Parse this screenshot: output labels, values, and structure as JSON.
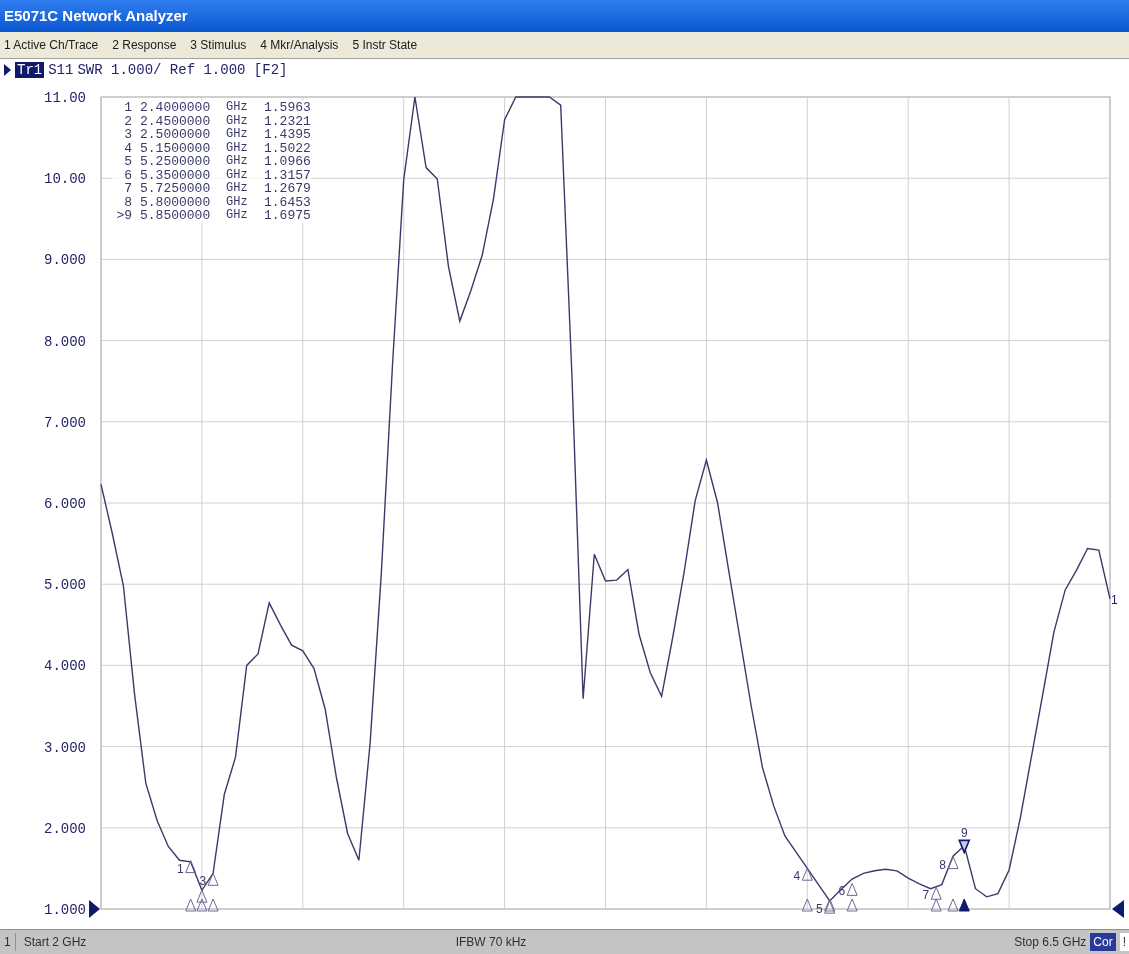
{
  "window": {
    "title": "E5071C Network Analyzer"
  },
  "menu": [
    "1 Active Ch/Trace",
    "2 Response",
    "3 Stimulus",
    "4 Mkr/Analysis",
    "5 Instr State"
  ],
  "trace_header": {
    "trace": "Tr1",
    "text": "SWR 1.000/ Ref 1.000 [F2]"
  },
  "markers": [
    {
      "number": "1",
      "frequency": "2.4000000",
      "unit": "GHz",
      "value": "1.5963"
    },
    {
      "number": "2",
      "frequency": "2.4500000",
      "unit": "GHz",
      "value": "1.2321"
    },
    {
      "number": "3",
      "frequency": "2.5000000",
      "unit": "GHz",
      "value": "1.4395"
    },
    {
      "number": "4",
      "frequency": "5.1500000",
      "unit": "GHz",
      "value": "1.5022"
    },
    {
      "number": "5",
      "frequency": "5.2500000",
      "unit": "GHz",
      "value": "1.0966"
    },
    {
      "number": "6",
      "frequency": "5.3500000",
      "unit": "GHz",
      "value": "1.3157"
    },
    {
      "number": "7",
      "frequency": "5.7250000",
      "unit": "GHz",
      "value": "1.2679"
    },
    {
      "number": "8",
      "frequency": "5.8000000",
      "unit": "GHz",
      "value": "1.6453"
    },
    {
      "number": ">9",
      "frequency": "5.8500000",
      "unit": "GHz",
      "value": "1.6975"
    }
  ],
  "plot": {
    "trace_end_label": "1",
    "marker_glyphs": [
      {
        "label": "1",
        "active": false
      },
      {
        "active": false
      },
      {
        "label": "3",
        "active": false
      },
      {
        "label": "4",
        "active": false
      },
      {
        "label": "5",
        "active": false
      },
      {
        "label": "6",
        "active": false
      },
      {
        "label": "7",
        "active": false
      },
      {
        "label": "8",
        "active": false
      },
      {
        "label": "9",
        "active": true
      }
    ],
    "chart_data": {
      "type": "line",
      "grid": true,
      "ylim": [
        1,
        11
      ],
      "yticks": [
        {
          "value": 11,
          "label": "11.00"
        },
        {
          "value": 10,
          "label": "10.00"
        },
        {
          "value": 9,
          "label": "9.000"
        },
        {
          "value": 8,
          "label": "8.000"
        },
        {
          "value": 7,
          "label": "7.000"
        },
        {
          "value": 6,
          "label": "6.000"
        },
        {
          "value": 5,
          "label": "5.000"
        },
        {
          "value": 4,
          "label": "4.000"
        },
        {
          "value": 3,
          "label": "3.000"
        },
        {
          "value": 2,
          "label": "2.000"
        },
        {
          "value": 1,
          "label": "1.000"
        }
      ],
      "categories": [
        null,
        null,
        null,
        null,
        null,
        null,
        null,
        null,
        null,
        null,
        null,
        null,
        null,
        null,
        null,
        null,
        null,
        null,
        null,
        null,
        null,
        null,
        null,
        null,
        null,
        null,
        null,
        null,
        null,
        null,
        null,
        null,
        null,
        null,
        null,
        null,
        null,
        null,
        null,
        null,
        null,
        null,
        null,
        null,
        null,
        null,
        null,
        null,
        null,
        null,
        null,
        null,
        null,
        null,
        null,
        null,
        null,
        null,
        null,
        null,
        null,
        null,
        null,
        null,
        null,
        null,
        null,
        null,
        null,
        null,
        null,
        null,
        null,
        null,
        null,
        null,
        null,
        null,
        null,
        null,
        null,
        null,
        null,
        null,
        null,
        null,
        null,
        null,
        null,
        null,
        null
      ],
      "series": [
        {
          "name": "S11",
          "color": "#3a3a6a",
          "values": [
            6.23,
            5.63,
            4.98,
            3.64,
            2.55,
            2.09,
            1.77,
            1.6,
            1.58,
            1.23,
            1.44,
            2.41,
            2.87,
            4.0,
            4.14,
            4.77,
            4.5,
            4.25,
            4.18,
            3.96,
            3.46,
            2.62,
            1.93,
            1.6,
            3.04,
            5.13,
            7.7,
            9.98,
            11,
            10.13,
            9.99,
            8.91,
            8.24,
            8.62,
            9.05,
            9.74,
            10.72,
            11,
            11,
            11,
            11,
            10.9,
            7.58,
            3.59,
            5.37,
            5.04,
            5.05,
            5.18,
            4.38,
            3.91,
            3.62,
            4.35,
            5.14,
            6.03,
            6.53,
            6.0,
            5.16,
            4.33,
            3.5,
            2.74,
            2.27,
            1.9,
            1.7,
            1.5,
            1.3,
            1.1,
            1.24,
            1.37,
            1.44,
            1.47,
            1.49,
            1.47,
            1.38,
            1.31,
            1.25,
            1.3,
            1.65,
            1.78,
            1.25,
            1.15,
            1.19,
            1.48,
            2.12,
            2.88,
            3.64,
            4.41,
            4.93,
            5.17,
            5.44,
            5.42,
            4.82
          ]
        }
      ]
    }
  },
  "status_bar": {
    "channel": "1",
    "start": "Start 2 GHz",
    "ifbw": "IFBW 70 kHz",
    "stop": "Stop 6.5 GHz",
    "correction": "Cor",
    "flag": "!"
  }
}
